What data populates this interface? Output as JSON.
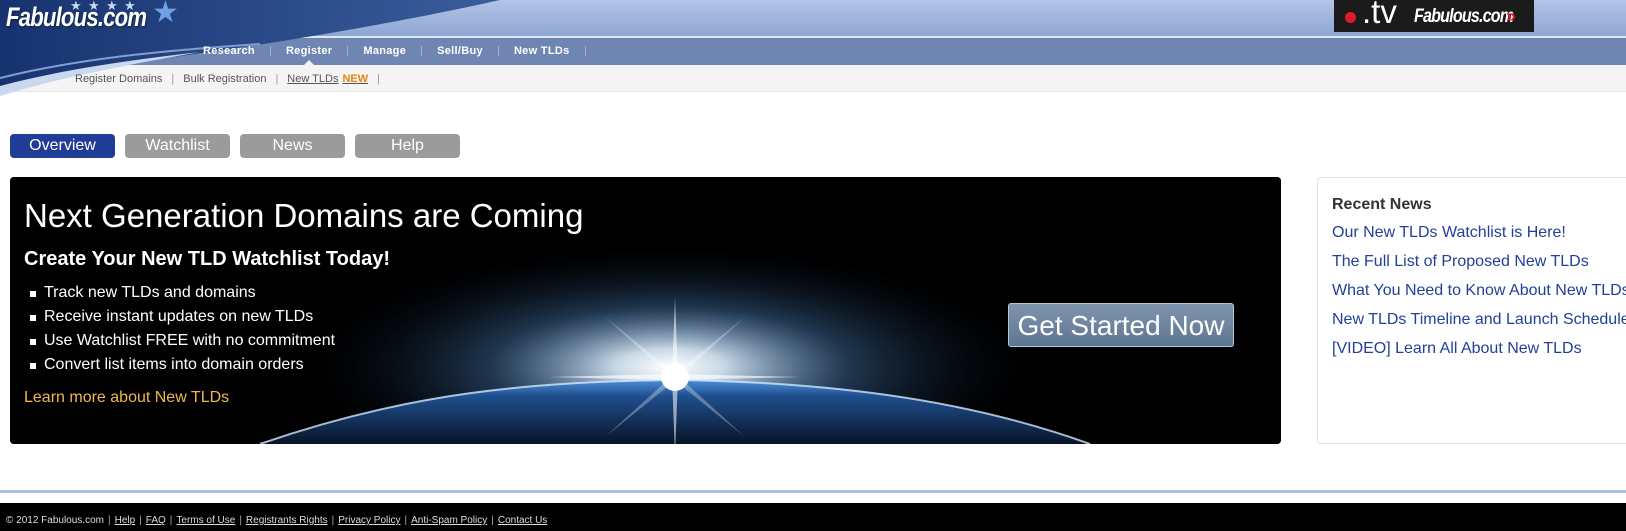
{
  "brand": {
    "logo_text": "Fabulous.com",
    "star_icon": "star-icon"
  },
  "ad": {
    "tv_text": ".tv",
    "brand_text": "Fabulous.com",
    "arrow": "»",
    "accent_color": "#e11a2b"
  },
  "main_nav": {
    "items": [
      {
        "label": "Research"
      },
      {
        "label": "Register"
      },
      {
        "label": "Manage"
      },
      {
        "label": "Sell/Buy"
      },
      {
        "label": "New TLDs"
      }
    ],
    "active": "Register"
  },
  "sub_nav": {
    "items": [
      {
        "label": "Register Domains"
      },
      {
        "label": "Bulk Registration"
      },
      {
        "label": "New TLDs",
        "badge": "NEW"
      }
    ]
  },
  "tabs": [
    {
      "label": "Overview",
      "active": true
    },
    {
      "label": "Watchlist",
      "active": false
    },
    {
      "label": "News",
      "active": false
    },
    {
      "label": "Help",
      "active": false
    }
  ],
  "hero": {
    "title": "Next Generation Domains are Coming",
    "subtitle": "Create Your New TLD Watchlist Today!",
    "bullets": [
      "Track new TLDs and domains",
      "Receive instant updates on new TLDs",
      "Use Watchlist FREE with no commitment",
      "Convert list items into domain orders"
    ],
    "learn_more": "Learn more about New TLDs",
    "cta": "Get Started Now"
  },
  "recent_news": {
    "title": "Recent News",
    "items": [
      "Our New TLDs Watchlist is Here!",
      "The Full List of Proposed New TLDs",
      "What You Need to Know About New TLDs",
      "New TLDs Timeline and Launch Schedule",
      "[VIDEO] Learn All About New TLDs"
    ]
  },
  "footer": {
    "copyright": "© 2012 Fabulous.com",
    "links": [
      "Help",
      "FAQ",
      "Terms of Use",
      "Registrants Rights",
      "Privacy Policy",
      "Anti-Spam Policy",
      "Contact Us"
    ]
  },
  "colors": {
    "header_blue": "#5f7aab",
    "tab_active": "#1f3c96",
    "tab_inactive": "#9b9b9b",
    "news_link": "#21409a",
    "hero_link": "#f0b94a",
    "new_badge": "#e8830c"
  }
}
